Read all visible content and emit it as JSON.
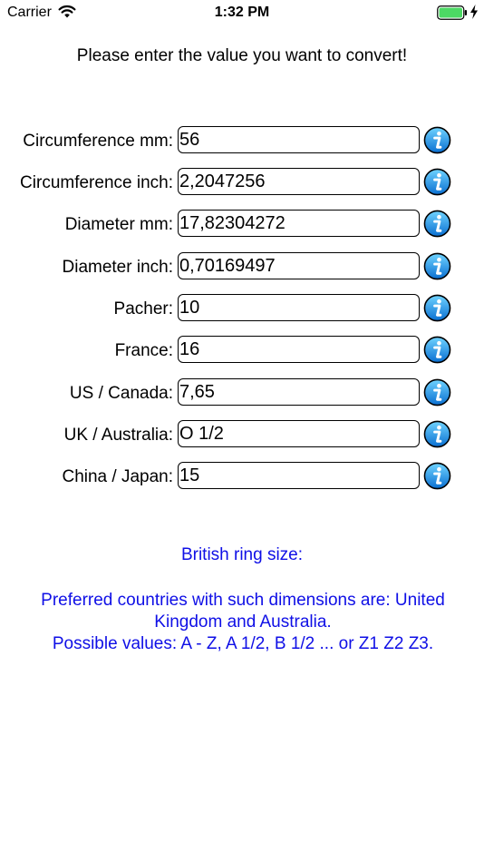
{
  "status": {
    "carrier": "Carrier",
    "time": "1:32 PM"
  },
  "prompt": "Please enter the value you want to convert!",
  "fields": [
    {
      "label": "Circumference mm:",
      "value": "56"
    },
    {
      "label": "Circumference inch:",
      "value": "2,2047256"
    },
    {
      "label": "Diameter mm:",
      "value": "17,82304272"
    },
    {
      "label": "Diameter inch:",
      "value": "0,70169497"
    },
    {
      "label": "Pacher:",
      "value": "10"
    },
    {
      "label": "France:",
      "value": "16"
    },
    {
      "label": "US / Canada:",
      "value": "7,65"
    },
    {
      "label": "UK / Australia:",
      "value": "O 1/2"
    },
    {
      "label": "China / Japan:",
      "value": "15"
    }
  ],
  "info": {
    "title": "British ring size:",
    "line1": "Preferred countries with such dimensions are: United Kingdom and Australia.",
    "line2": "Possible values: A - Z, A 1/2, B 1/2 ... or Z1 Z2 Z3."
  },
  "colors": {
    "info_text": "#0f0fe6",
    "battery": "#4cd964",
    "info_icon": "#1e90ff"
  }
}
